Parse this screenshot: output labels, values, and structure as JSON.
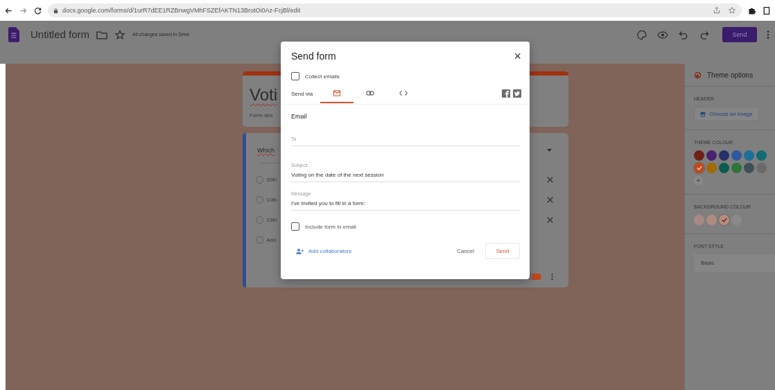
{
  "browser": {
    "url": "docs.google.com/forms/d/1urR7dEE1RZBnwgVMhFSZEfAKTN13BrotOi0Az-FcjBl/edit"
  },
  "header": {
    "title": "Untitled form",
    "status": "All changes saved in Drive",
    "send_button": "Send"
  },
  "form": {
    "title": "Voti",
    "description": "Form des",
    "question": "Which",
    "options": [
      {
        "label": "30th",
        "selected": false
      },
      {
        "label": "10th",
        "selected": false
      },
      {
        "label": "19th",
        "selected": false
      }
    ],
    "add_option": {
      "label": "Add",
      "selected": false
    },
    "required": true
  },
  "dialog": {
    "title": "Send form",
    "close": "×",
    "collect_emails": {
      "label": "Collect emails",
      "checked": false
    },
    "send_via": "Send via",
    "tabs": [
      {
        "kind": "email",
        "selected": true
      },
      {
        "kind": "link",
        "selected": false
      },
      {
        "kind": "embed",
        "selected": false
      }
    ],
    "section": "Email",
    "to": {
      "placeholder": "To"
    },
    "subject": {
      "label": "Subject",
      "value": "Voting on the date of the next session"
    },
    "message": {
      "label": "Message",
      "value": "I've invited you to fill in a form:"
    },
    "include_form": {
      "label": "Include form in email",
      "checked": false
    },
    "add_collaborators": "Add collaborators",
    "cancel": "Cancel",
    "send": "Send"
  },
  "theme_panel": {
    "title": "Theme options",
    "header_label": "HEADER",
    "choose_image": "Choose an image",
    "theme_colour_label": "THEME COLOUR",
    "theme_colours": [
      {
        "color": "#6e2019",
        "selected": false
      },
      {
        "color": "#4a2270",
        "selected": false
      },
      {
        "color": "#25306b",
        "selected": false
      },
      {
        "color": "#2c5a9c",
        "selected": false
      },
      {
        "color": "#1c6f98",
        "selected": false
      },
      {
        "color": "#126a72",
        "selected": false
      },
      {
        "color": "#c2471b",
        "selected": true
      },
      {
        "color": "#a36a00",
        "selected": false
      },
      {
        "color": "#0b5c4c",
        "selected": false
      },
      {
        "color": "#2b7536",
        "selected": false
      },
      {
        "color": "#3d4f58",
        "selected": false
      },
      {
        "color": "#6a6a6a",
        "selected": false
      }
    ],
    "add_colour": "+",
    "background_colour_label": "BACKGROUND COLOUR",
    "background_colours": [
      {
        "color": "#a88a85",
        "selected": false
      },
      {
        "color": "#b08c80",
        "selected": false
      },
      {
        "color": "#b88c7e",
        "selected": true
      },
      {
        "color": "#8a8a8a",
        "selected": false
      }
    ],
    "font_style_label": "FONT STYLE",
    "font_style": "Basic"
  }
}
